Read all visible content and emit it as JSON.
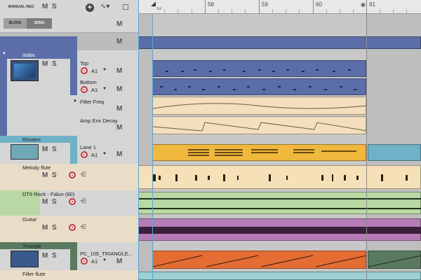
{
  "header": {
    "manual_rec": "MANUAL REC",
    "m": "M",
    "s": "S",
    "plus": "+",
    "block": "BLOCK",
    "song": "SONG"
  },
  "ruler": {
    "bar_markers": [
      "58",
      "59",
      "60",
      "61"
    ],
    "loop_start_label": "1/4"
  },
  "tracks": {
    "stabs": {
      "name": "stabs",
      "lanes": [
        "Top",
        "Bottom"
      ],
      "automation": [
        "Filter Freq",
        "Amp Env Decay"
      ],
      "a1": "A1"
    },
    "rhodes": {
      "name": "Rhodes",
      "lane": "Lane 1",
      "a1": "A1"
    },
    "melody_flute": {
      "name": "Melody flute"
    },
    "dt6": {
      "name": "DT6 Rock - Falun  (80)"
    },
    "guitar": {
      "name": "Guitar"
    },
    "triangle": {
      "name": "Triangle",
      "lane": "PC_105_TRIANGLE...",
      "a1": "A1"
    },
    "filler_flute": {
      "name": "Filler flute"
    }
  },
  "labels": {
    "m": "M",
    "s": "S",
    "a1_small": "A1",
    "m_small": "M"
  },
  "colors": {
    "stabs": "#5b6ea8",
    "automation": "#f3dfbd",
    "rhodes": "#f0b93e",
    "melody_flute": "#f5e0b8",
    "dt6": "#b9d9a4",
    "guitar": "#b67cb5",
    "triangle": "#e46d33",
    "filler": "#9bd0d4"
  }
}
